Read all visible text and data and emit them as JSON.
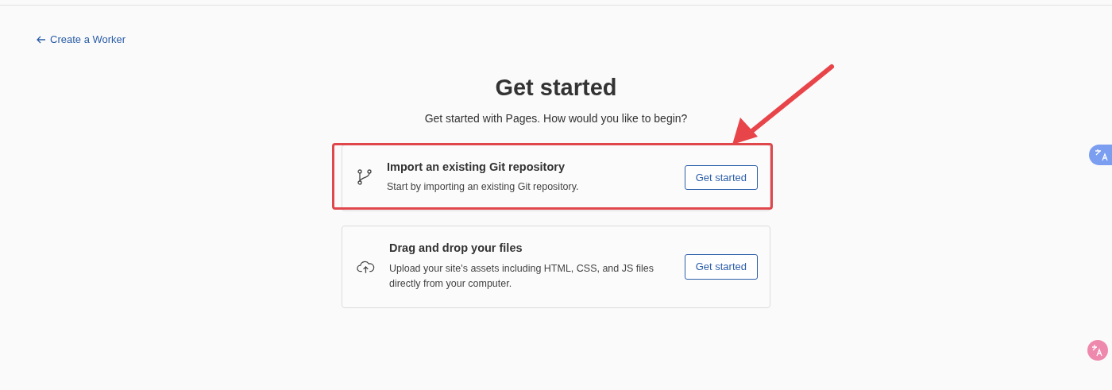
{
  "back_link": {
    "label": "Create a Worker"
  },
  "heading": "Get started",
  "subtitle": "Get started with Pages. How would you like to begin?",
  "options": [
    {
      "kind": "git",
      "title": "Import an existing Git repository",
      "description": "Start by importing an existing Git repository.",
      "button": "Get started",
      "highlighted": true
    },
    {
      "kind": "upload",
      "title": "Drag and drop your files",
      "description": "Upload your site's assets including HTML, CSS, and JS files directly from your computer.",
      "button": "Get started",
      "highlighted": false
    }
  ]
}
